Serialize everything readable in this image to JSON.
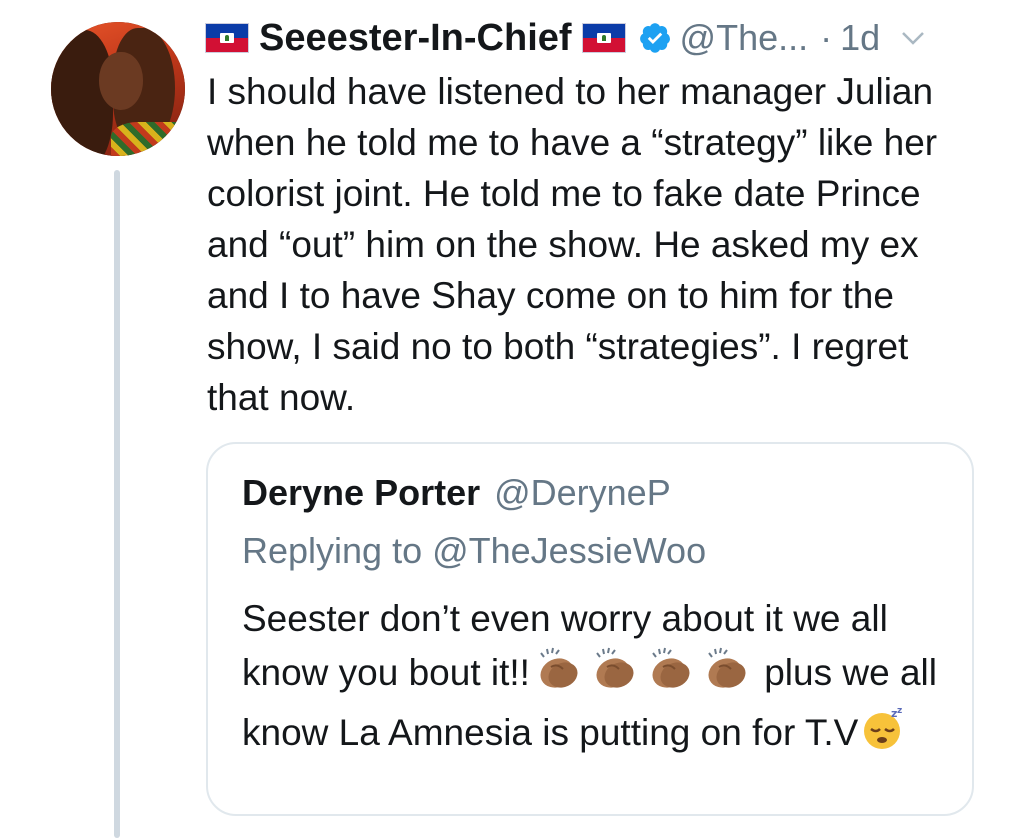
{
  "tweet": {
    "display_name": "Seeester-In-Chief",
    "handle": "@The...",
    "separator": "·",
    "time": "1d",
    "name_flag_icon": "haiti-flag-icon",
    "verified_icon": "verified-badge-icon",
    "menu_icon": "chevron-down-icon",
    "text": "I should have listened to her manager Julian when he told me to have a “strategy” like her colorist joint. He told me to fake date Prince and “out” him on the show. He asked my ex and I to have Shay come on to him for the show, I said no to both “strategies”. I regret that now.",
    "colors": {
      "text": "#14171a",
      "secondary": "#657786",
      "verified": "#1da1f2",
      "border": "#e1e8ed"
    }
  },
  "quoted": {
    "name": "Deryne Porter",
    "handle": "@DeryneP",
    "replying_to": "Replying to @TheJessieWoo",
    "text_part1": "Seester don’t even worry about it we all know you bout it!!",
    "clap_emoji_icon": "clapping-hands-icon",
    "clap_count": 4,
    "text_part2": "plus we all know La Amnesia is putting on for T.V",
    "end_emoji_icon": "sleeping-face-icon"
  }
}
